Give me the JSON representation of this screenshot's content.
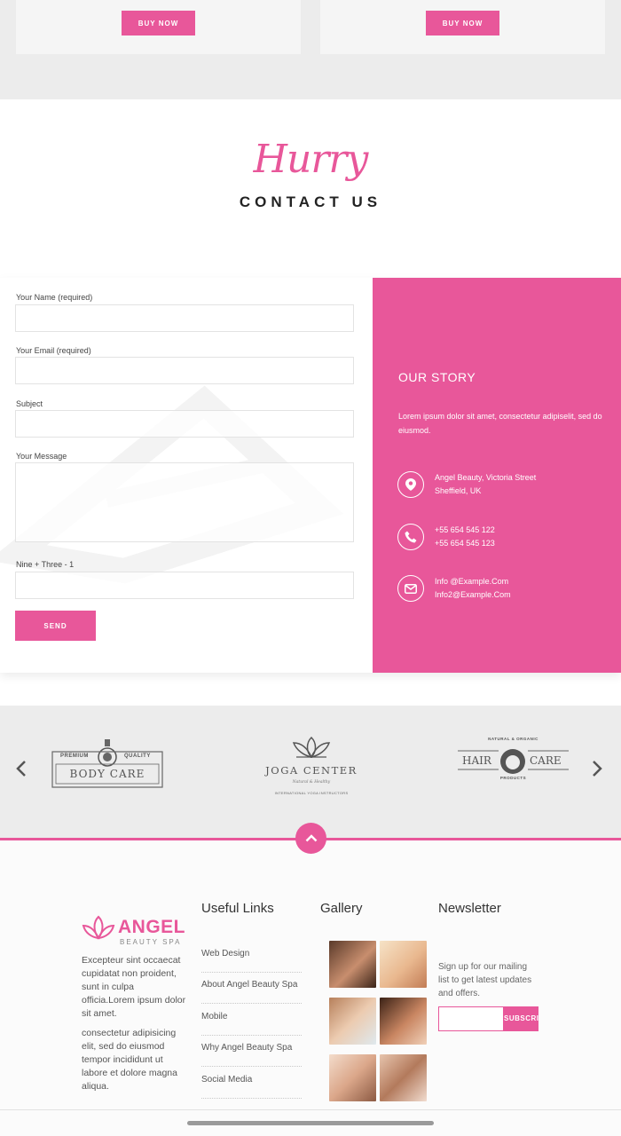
{
  "pricing": {
    "buy_label_1": "BUY NOW",
    "buy_label_2": "BUY NOW"
  },
  "heading": {
    "script_text": "Hurry",
    "title": "CONTACT US"
  },
  "form": {
    "name_label": "Your Name (required)",
    "email_label": "Your Email (required)",
    "subject_label": "Subject",
    "message_label": "Your Message",
    "captcha_label": "Nine + Three - 1",
    "send_label": "SEND"
  },
  "story": {
    "title": "OUR STORY",
    "text": "Lorem ipsum dolor sit amet, consectetur adipiselit, sed do eiusmod.",
    "address_line1": "Angel Beauty, Victoria Street",
    "address_line2": "Sheffield, UK",
    "phone_line1": "+55 654 545 122",
    "phone_line2": "+55 654 545 123",
    "email_line1": "Info @Example.Com",
    "email_line2": "Info2@Example.Com"
  },
  "partners": {
    "logo1_top_left": "PREMIUM",
    "logo1_top_right": "QUALITY",
    "logo1_name": "BODY CARE",
    "logo2_name": "JOGA CENTER",
    "logo2_tag": "Natural & Healthy",
    "logo2_sub": "INTERNATIONAL YOGA INSTRUCTORS",
    "logo3_top": "NATURAL & ORGANIC",
    "logo3_left": "HAIR",
    "logo3_right": "CARE",
    "logo3_bottom": "PRODUCTS"
  },
  "footer": {
    "brand_name": "ANGEL",
    "brand_sub": "BEAUTY SPA",
    "about_p1": "Excepteur sint occaecat cupidatat non proident, sunt in culpa officia.Lorem ipsum dolor sit amet.",
    "about_p2": "consectetur adipisicing elit, sed do eiusmod tempor incididunt ut labore et dolore magna aliqua.",
    "useful_links_title": "Useful Links",
    "links": [
      "Web Design",
      "About Angel Beauty Spa",
      "Mobile",
      "Why Angel Beauty Spa",
      "Social Media"
    ],
    "gallery_title": "Gallery",
    "newsletter_title": "Newsletter",
    "newsletter_text": "Sign up for our mailing list to get latest updates and offers.",
    "subscribe_label": "SUBSCRIBE"
  },
  "colors": {
    "accent": "#e8579a",
    "background_gray": "#ececec",
    "text_dark": "#222222"
  }
}
